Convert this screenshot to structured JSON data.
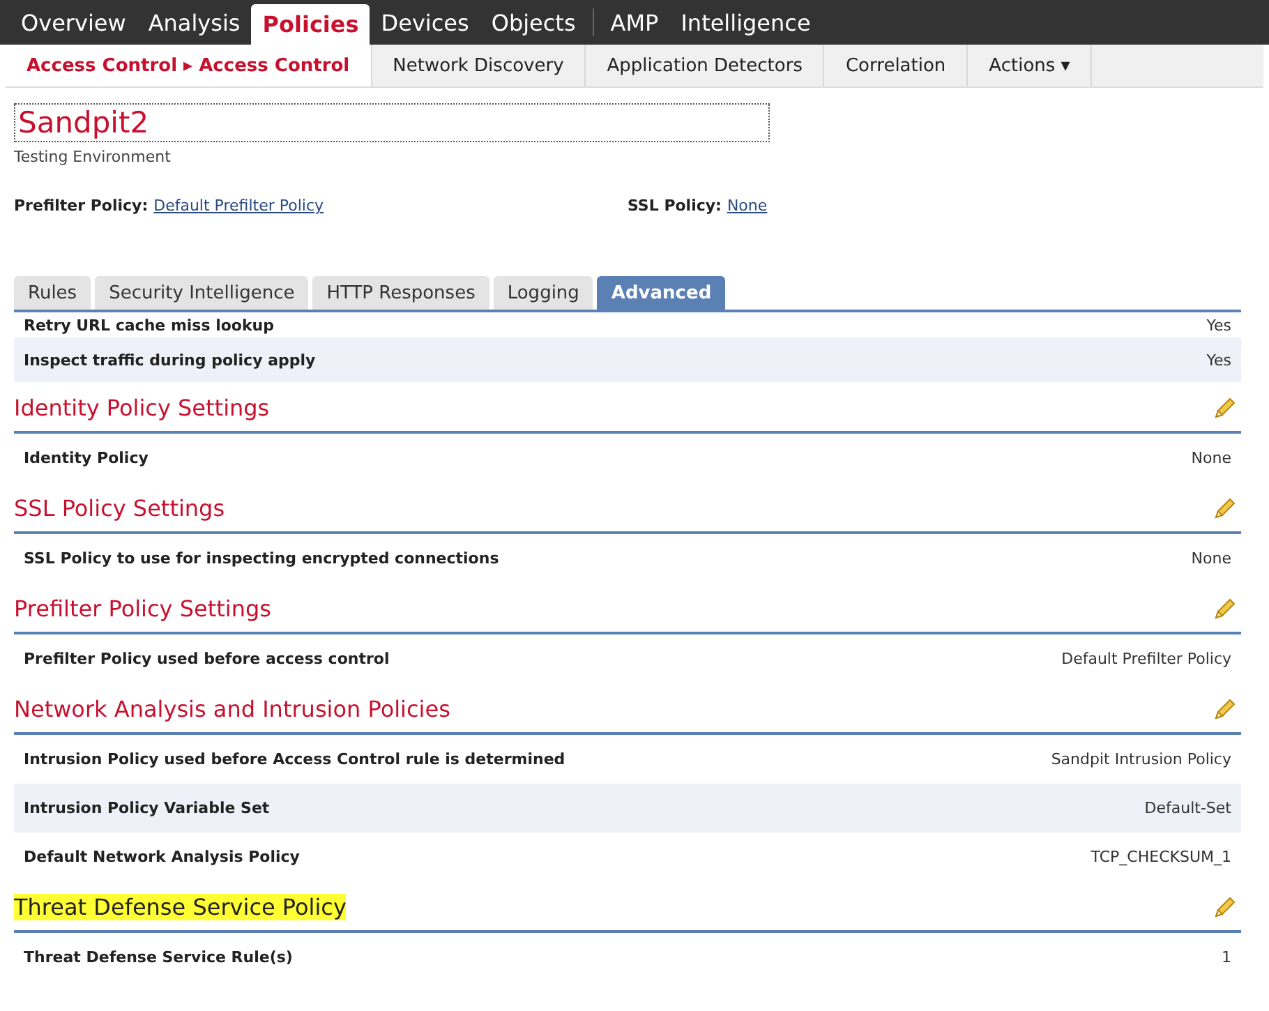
{
  "top_nav": [
    {
      "label": "Overview",
      "selected": false
    },
    {
      "label": "Analysis",
      "selected": false
    },
    {
      "label": "Policies",
      "selected": true
    },
    {
      "label": "Devices",
      "selected": false
    },
    {
      "label": "Objects",
      "selected": false,
      "divider_after": true
    },
    {
      "label": "AMP",
      "selected": false
    },
    {
      "label": "Intelligence",
      "selected": false
    }
  ],
  "sub_nav": [
    {
      "label": "Access Control ▸ Access Control",
      "selected": true
    },
    {
      "label": "Network Discovery",
      "selected": false
    },
    {
      "label": "Application Detectors",
      "selected": false
    },
    {
      "label": "Correlation",
      "selected": false
    },
    {
      "label": "Actions ▾",
      "selected": false
    }
  ],
  "policy": {
    "name": "Sandpit2",
    "description": "Testing Environment",
    "prefilter_label": "Prefilter Policy:",
    "prefilter_value": "Default Prefilter Policy",
    "ssl_label": "SSL Policy:",
    "ssl_value": "None"
  },
  "tabs": [
    {
      "label": "Rules",
      "selected": false
    },
    {
      "label": "Security Intelligence",
      "selected": false
    },
    {
      "label": "HTTP Responses",
      "selected": false
    },
    {
      "label": "Logging",
      "selected": false
    },
    {
      "label": "Advanced",
      "selected": true
    }
  ],
  "top_rows": [
    {
      "label": "Retry URL cache miss lookup",
      "value": "Yes"
    },
    {
      "label": "Inspect traffic during policy apply",
      "value": "Yes"
    }
  ],
  "sections": [
    {
      "title": "Identity Policy Settings",
      "highlighted": false,
      "rows": [
        {
          "label": "Identity Policy",
          "value": "None"
        }
      ]
    },
    {
      "title": "SSL Policy Settings",
      "highlighted": false,
      "rows": [
        {
          "label": "SSL Policy to use for inspecting encrypted connections",
          "value": "None"
        }
      ]
    },
    {
      "title": "Prefilter Policy Settings",
      "highlighted": false,
      "rows": [
        {
          "label": "Prefilter Policy used before access control",
          "value": "Default Prefilter Policy"
        }
      ]
    },
    {
      "title": "Network Analysis and Intrusion Policies",
      "highlighted": false,
      "rows": [
        {
          "label": "Intrusion Policy used before Access Control rule is determined",
          "value": "Sandpit Intrusion Policy"
        },
        {
          "label": "Intrusion Policy Variable Set",
          "value": "Default-Set"
        },
        {
          "label": "Default Network Analysis Policy",
          "value": "TCP_CHECKSUM_1"
        }
      ]
    },
    {
      "title": "Threat Defense Service Policy",
      "highlighted": true,
      "rows": [
        {
          "label": "Threat Defense Service Rule(s)",
          "value": "1"
        }
      ]
    }
  ]
}
